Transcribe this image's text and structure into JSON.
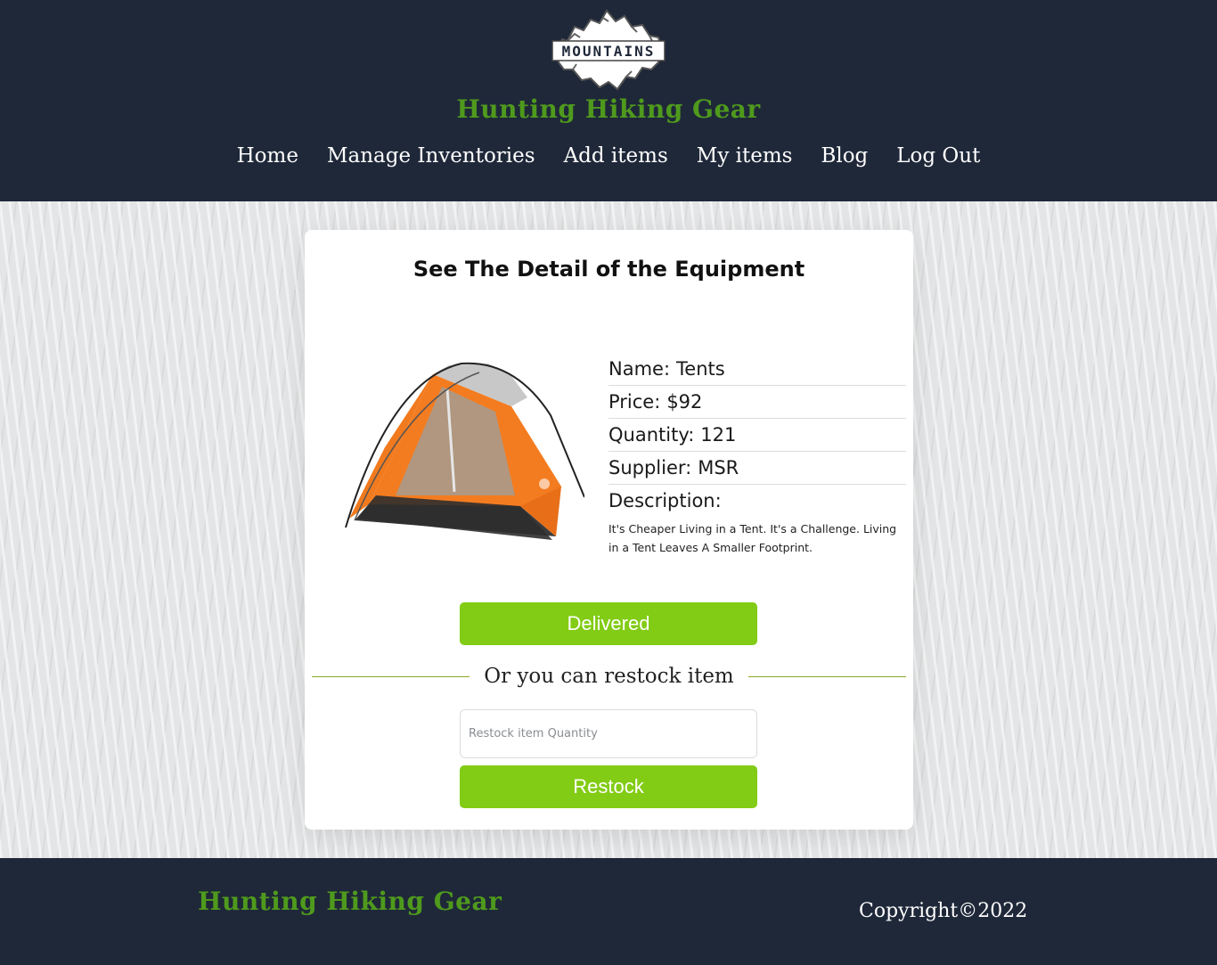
{
  "header": {
    "logo_text": "MOUNTAINS",
    "brand": "Hunting Hiking Gear",
    "nav": [
      {
        "label": "Home"
      },
      {
        "label": "Manage Inventories"
      },
      {
        "label": "Add items"
      },
      {
        "label": "My items"
      },
      {
        "label": "Blog"
      },
      {
        "label": "Log Out"
      }
    ]
  },
  "card": {
    "title": "See The Detail of the Equipment",
    "item": {
      "name_label": "Name:",
      "name": "Tents",
      "price_label": "Price:",
      "price": "$92",
      "quantity_label": "Quantity:",
      "quantity": "121",
      "supplier_label": "Supplier:",
      "supplier": "MSR",
      "description_label": "Description:",
      "description": "It's Cheaper Living in a Tent. It's a Challenge. Living in a Tent Leaves A Smaller Footprint."
    },
    "delivered_label": "Delivered",
    "divider_text": "Or you can restock item",
    "restock_placeholder": "Restock item Quantity",
    "restock_label": "Restock"
  },
  "footer": {
    "brand": "Hunting Hiking Gear",
    "copyright": "Copyright©2022"
  },
  "colors": {
    "header_bg": "#1f2839",
    "brand_green": "#4f9a1d",
    "button_green": "#82cc15"
  }
}
